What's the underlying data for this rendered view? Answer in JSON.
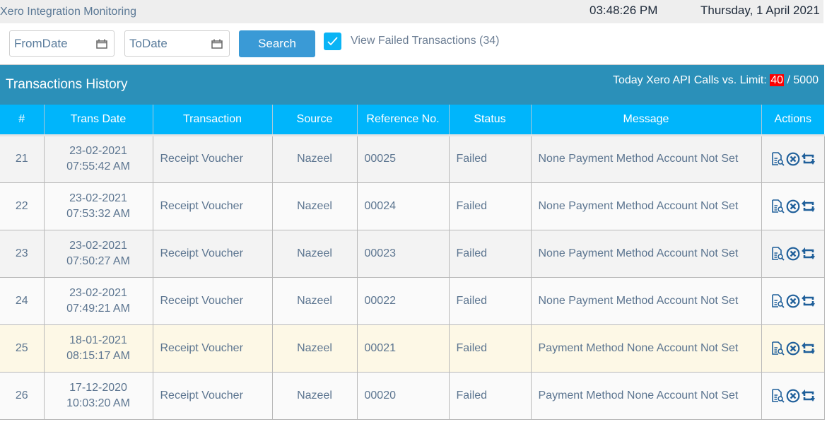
{
  "header": {
    "app_title": "Xero Integration Monitoring",
    "time": "03:48:26 PM",
    "date": "Thursday, 1 April 2021"
  },
  "filters": {
    "from_date_placeholder": "FromDate",
    "to_date_placeholder": "ToDate",
    "search_label": "Search",
    "view_failed_checked": true,
    "view_failed_label": "View Failed Transactions (34)"
  },
  "panel": {
    "title": "Transactions History",
    "api_calls_label": "Today Xero API Calls vs. Limit: ",
    "api_calls_used": "40",
    "api_calls_limit": " / 5000",
    "accent_color": "#2b90b9",
    "header_color": "#00b5fb",
    "alert_color": "#ff0000"
  },
  "table": {
    "columns": [
      "#",
      "Trans Date",
      "Transaction",
      "Source",
      "Reference No.",
      "Status",
      "Message",
      "Actions"
    ],
    "rows": [
      {
        "num": "21",
        "date": "23-02-2021",
        "time": "07:55:42 AM",
        "transaction": "Receipt Voucher",
        "source": "Nazeel",
        "ref": "00025",
        "status": "Failed",
        "message": "None Payment Method Account Not Set"
      },
      {
        "num": "22",
        "date": "23-02-2021",
        "time": "07:53:32 AM",
        "transaction": "Receipt Voucher",
        "source": "Nazeel",
        "ref": "00024",
        "status": "Failed",
        "message": "None Payment Method Account Not Set"
      },
      {
        "num": "23",
        "date": "23-02-2021",
        "time": "07:50:27 AM",
        "transaction": "Receipt Voucher",
        "source": "Nazeel",
        "ref": "00023",
        "status": "Failed",
        "message": "None Payment Method Account Not Set"
      },
      {
        "num": "24",
        "date": "23-02-2021",
        "time": "07:49:21 AM",
        "transaction": "Receipt Voucher",
        "source": "Nazeel",
        "ref": "00022",
        "status": "Failed",
        "message": "None Payment Method Account Not Set"
      },
      {
        "num": "25",
        "date": "18-01-2021",
        "time": "08:15:17 AM",
        "transaction": "Receipt Voucher",
        "source": "Nazeel",
        "ref": "00021",
        "status": "Failed",
        "message": "Payment Method None Account Not Set"
      },
      {
        "num": "26",
        "date": "17-12-2020",
        "time": "10:03:20 AM",
        "transaction": "Receipt Voucher",
        "source": "Nazeel",
        "ref": "00020",
        "status": "Failed",
        "message": "Payment Method None Account Not Set"
      }
    ],
    "row_actions": [
      "view-details-icon",
      "cancel-icon",
      "retry-icon"
    ]
  }
}
